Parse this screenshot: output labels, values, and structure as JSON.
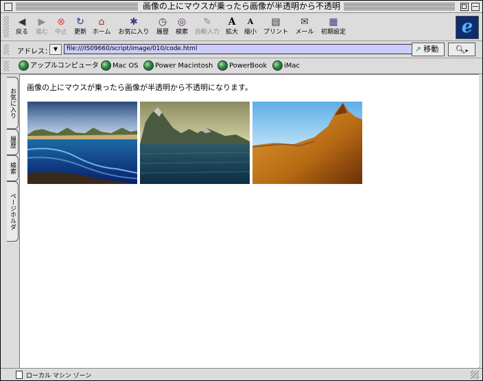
{
  "window": {
    "title": "画像の上にマウスが乗ったら画像が半透明から不透明"
  },
  "toolbar": {
    "buttons": [
      {
        "label": "戻る",
        "icon": "back-arrow-icon"
      },
      {
        "label": "進む",
        "icon": "forward-arrow-icon"
      },
      {
        "label": "中止",
        "icon": "stop-icon"
      },
      {
        "label": "更新",
        "icon": "refresh-icon"
      },
      {
        "label": "ホーム",
        "icon": "home-icon"
      },
      {
        "label": "お気に入り",
        "icon": "favorites-icon"
      },
      {
        "label": "履歴",
        "icon": "history-icon"
      },
      {
        "label": "検索",
        "icon": "search-icon"
      },
      {
        "label": "自動入力",
        "icon": "autofill-icon"
      },
      {
        "label": "拡大",
        "icon": "text-larger-icon"
      },
      {
        "label": "縮小",
        "icon": "text-smaller-icon"
      },
      {
        "label": "プリント",
        "icon": "print-icon"
      },
      {
        "label": "メール",
        "icon": "mail-icon"
      },
      {
        "label": "初期設定",
        "icon": "preferences-icon"
      }
    ],
    "logo": "e"
  },
  "address": {
    "label": "アドレス：",
    "url": "file:///IS09660/script/image/010/code.html",
    "go_label": "移動"
  },
  "favorites": [
    {
      "label": "アップルコンピュータ"
    },
    {
      "label": "Mac OS"
    },
    {
      "label": "Power Macintosh"
    },
    {
      "label": "PowerBook"
    },
    {
      "label": "iMac"
    }
  ],
  "side_tabs": [
    {
      "label": "お気に入り"
    },
    {
      "label": "履歴"
    },
    {
      "label": "検索"
    },
    {
      "label": "ページホルダ"
    }
  ],
  "content": {
    "text": "画像の上にマウスが乗ったら画像が半透明から不透明になります。",
    "images": [
      {
        "name": "beach-landscape-image"
      },
      {
        "name": "mountain-lake-image"
      },
      {
        "name": "desert-peak-image"
      }
    ]
  },
  "status": {
    "zone": "ローカル マシン ゾーン"
  }
}
